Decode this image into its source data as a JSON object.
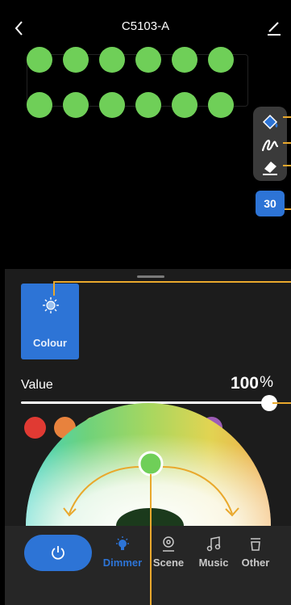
{
  "header": {
    "title": "C5103-A"
  },
  "canvas": {
    "pixel_color": "#6fcf58",
    "rows": 2,
    "cols": 6
  },
  "tools": {
    "items": [
      "paint-bucket-icon",
      "pen-icon",
      "eraser-icon"
    ],
    "count_badge": "30"
  },
  "mode": {
    "label": "Colour"
  },
  "value": {
    "label": "Value",
    "number": "100",
    "unit": "%",
    "level": 1.0
  },
  "swatches": [
    "#e03a33",
    "#e8823d",
    "#eae56a",
    "#75c65a",
    "#7fd3db",
    "#2450a6",
    "#9d5cb6"
  ],
  "nav": {
    "items": [
      {
        "label": "Dimmer",
        "icon": "bulb-icon",
        "active": true
      },
      {
        "label": "Scene",
        "icon": "scene-icon",
        "active": false
      },
      {
        "label": "Music",
        "icon": "music-icon",
        "active": false
      },
      {
        "label": "Other",
        "icon": "other-icon",
        "active": false
      }
    ]
  },
  "colors": {
    "accent": "#2d74d6",
    "annotation": "#e9a82c"
  }
}
